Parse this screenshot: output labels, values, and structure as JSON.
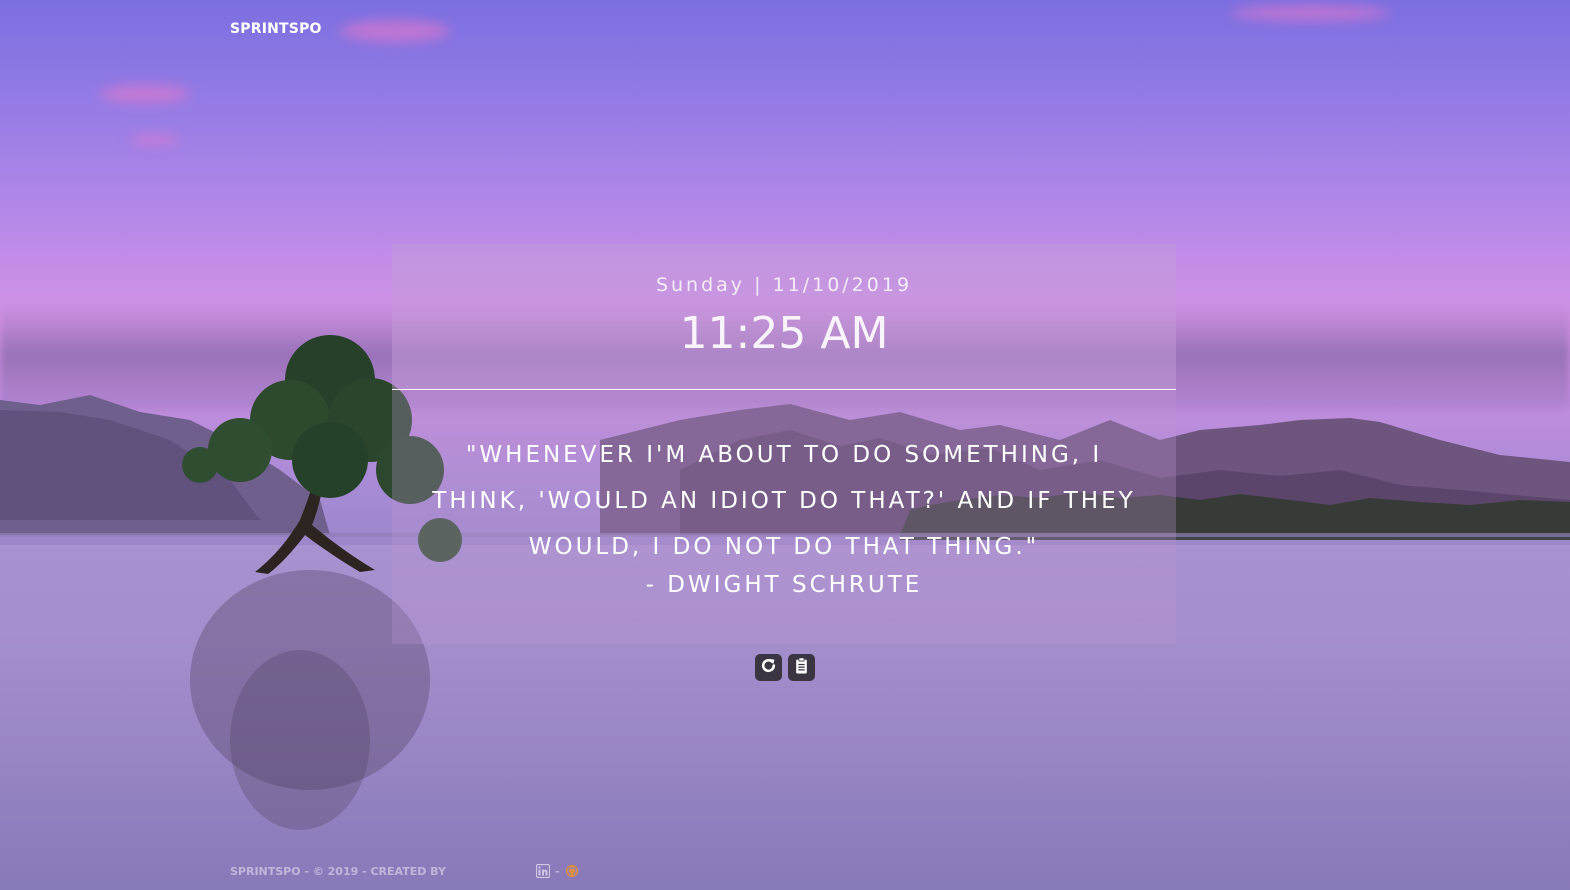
{
  "header": {
    "brand": "SPRINTSPO"
  },
  "clock": {
    "date_line": "Sunday | 11/10/2019",
    "time": "11:25 AM"
  },
  "quote": {
    "text": "\"Whenever I'm about to do something, I think, 'Would an idiot do that?' And if they would, I do not do that thing.\"",
    "author": "- Dwight Schrute"
  },
  "actions": {
    "refresh_icon": "refresh-icon",
    "copy_icon": "clipboard-icon"
  },
  "footer": {
    "prefix": "SPRINTSPO - © 2019 - CREATED BY",
    "separator": "-",
    "icons": [
      "linkedin-icon",
      "github-icon"
    ]
  },
  "colors": {
    "panel": "#be96d2",
    "button": "#3a3540",
    "github_accent": "#e8932c"
  }
}
